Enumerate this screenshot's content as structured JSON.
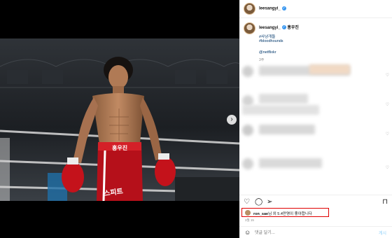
{
  "account": {
    "username": "leesangyi_"
  },
  "caption": {
    "collaborator": "홍우진",
    "hashtags": [
      "#사냥개들",
      "#bloodhounds"
    ],
    "mention": "@netflixkr",
    "time_ago": "3주"
  },
  "photo": {
    "trunks_text_top": "홍우진",
    "trunks_text_side": "스피트"
  },
  "actions": {
    "like_icon": "heart-icon",
    "comment_icon": "comment-icon",
    "share_icon": "share-icon",
    "save_icon": "bookmark-icon"
  },
  "likes": {
    "user": "ron_sae",
    "text": "님 외 5.4만명이 좋아합니다"
  },
  "post_date": "3월 15",
  "comment_box": {
    "placeholder": "댓글 달기...",
    "post_label": "게시"
  },
  "colors": {
    "verified": "#3897f0",
    "highlight_box": "#e00000",
    "link": "#00376b"
  }
}
